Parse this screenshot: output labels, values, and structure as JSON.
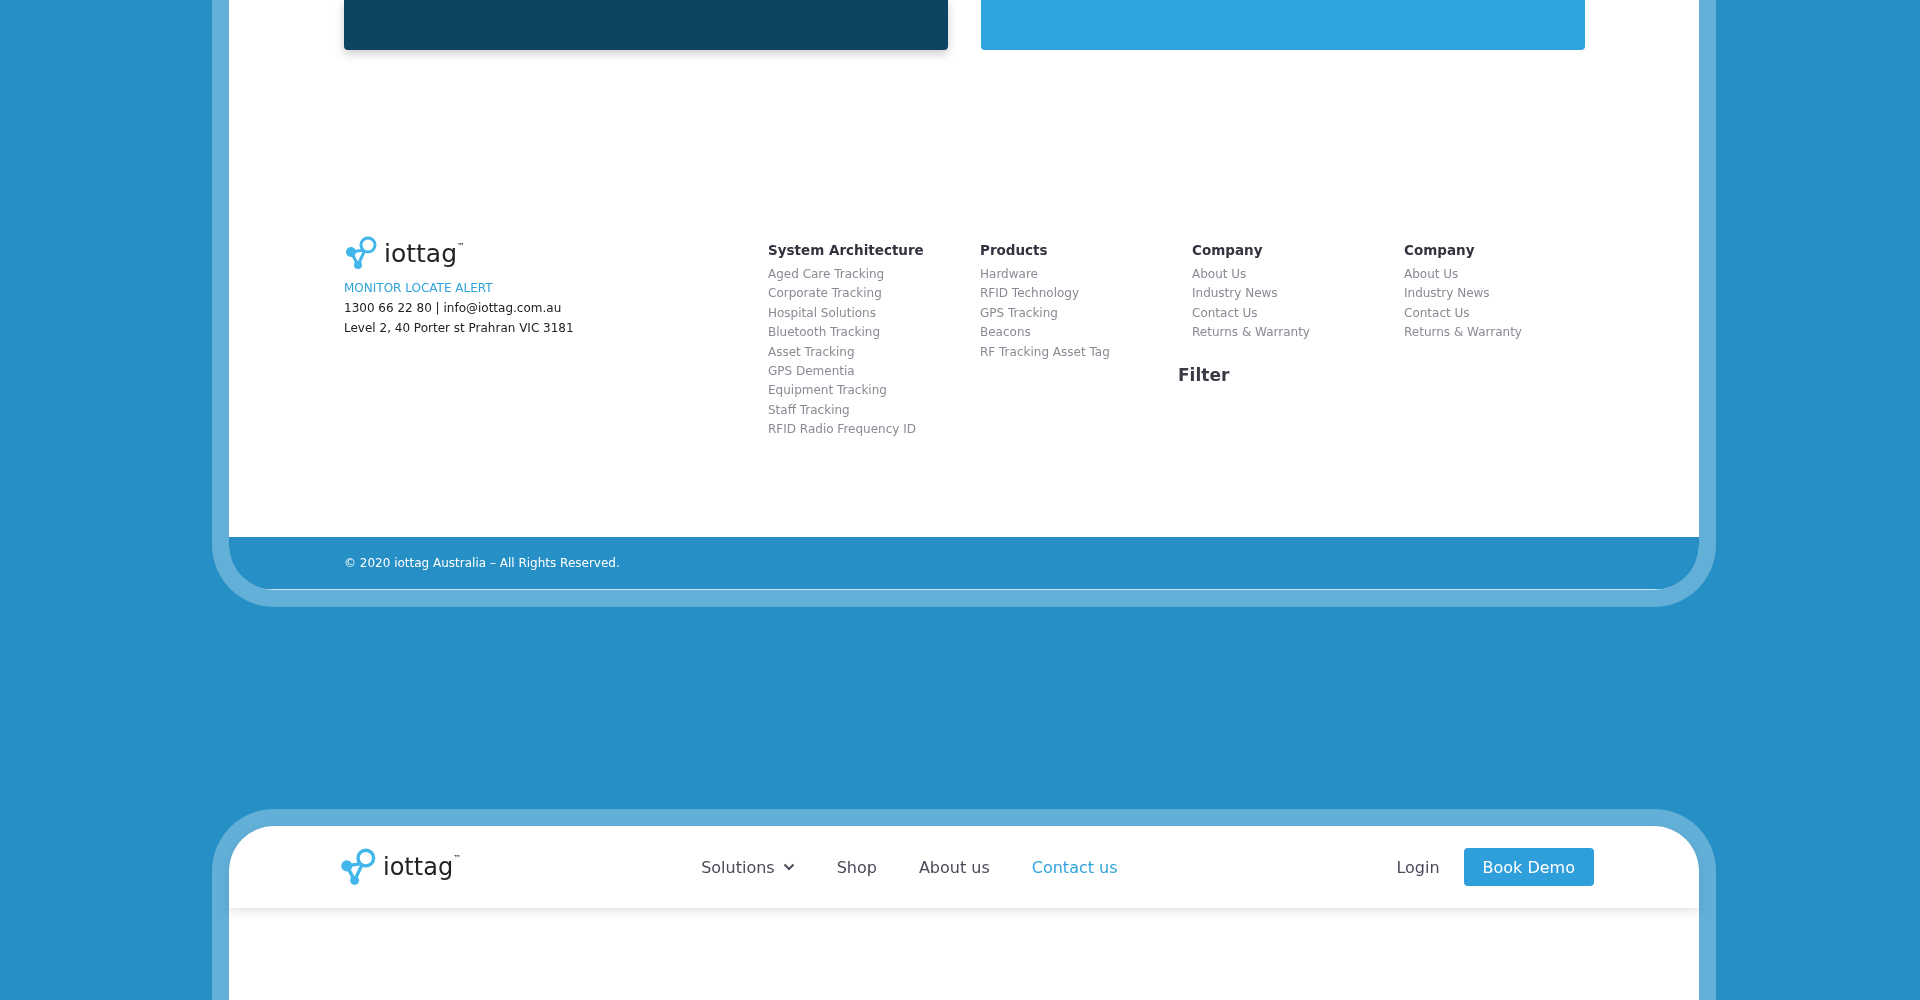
{
  "footer": {
    "brand": {
      "name": "iottag",
      "trademark": "™",
      "tagline": "MONITOR LOCATE ALERT",
      "contact": "1300 66 22 80 | info@iottag.com.au",
      "address": "Level 2, 40 Porter st Prahran VIC 3181"
    },
    "columns": [
      {
        "heading": "System Architecture",
        "links": [
          "Aged Care Tracking",
          "Corporate Tracking",
          "Hospital Solutions",
          "Bluetooth Tracking",
          "Asset Tracking",
          "GPS Dementia",
          "Equipment Tracking",
          "Staff Tracking",
          "RFID Radio Frequency ID"
        ]
      },
      {
        "heading": "Products",
        "links": [
          "Hardware",
          "RFID Technology",
          "GPS Tracking",
          "Beacons",
          "RF Tracking Asset Tag"
        ]
      },
      {
        "heading": "Company",
        "links": [
          "About Us",
          "Industry News",
          "Contact Us",
          "Returns & Warranty"
        ]
      },
      {
        "heading": "Company",
        "links": [
          "About Us",
          "Industry News",
          "Contact Us",
          "Returns & Warranty"
        ]
      }
    ],
    "filter_heading": "Filter",
    "copyright": "© 2020 iottag Australia – All Rights Reserved."
  },
  "header": {
    "brand": {
      "name": "iottag",
      "trademark": "™"
    },
    "nav": [
      {
        "label": "Solutions",
        "dropdown": true,
        "selected": false
      },
      {
        "label": "Shop",
        "dropdown": false,
        "selected": false
      },
      {
        "label": "About us",
        "dropdown": false,
        "selected": false
      },
      {
        "label": "Contact us",
        "dropdown": false,
        "selected": true
      }
    ],
    "login": "Login",
    "cta": "Book Demo"
  }
}
